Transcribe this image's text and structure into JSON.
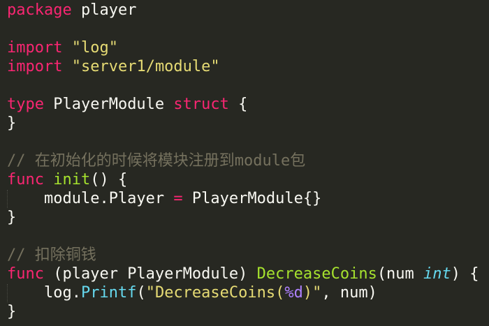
{
  "code": {
    "pkg_kw": "package",
    "pkg_name": " player",
    "import_kw": "import",
    "import1": "\"log\"",
    "import2": "\"server1/module\"",
    "type_kw": "type",
    "type_name": " PlayerModule ",
    "struct_kw": "struct",
    "brace_open": " {",
    "brace_close": "}",
    "comment1": "// 在初始化的时候将模块注册到module包",
    "func_kw": "func",
    "init_name": "init",
    "init_tail": "() {",
    "assign_lhs": "    module.Player ",
    "assign_op": "=",
    "assign_rhs": " PlayerModule{}",
    "comment2": "// 扣除铜钱",
    "recv": " (player PlayerModule) ",
    "method_name": "DecreaseCoins",
    "param_open": "(num ",
    "param_type": "int",
    "param_close": ") {",
    "log_prefix": "    log.",
    "printf": "Printf",
    "paren_open": "(",
    "fmt_str_a": "\"DecreaseCoins(",
    "fmt_verb": "%d",
    "fmt_str_b": ")\"",
    "args_tail": ", num)"
  }
}
